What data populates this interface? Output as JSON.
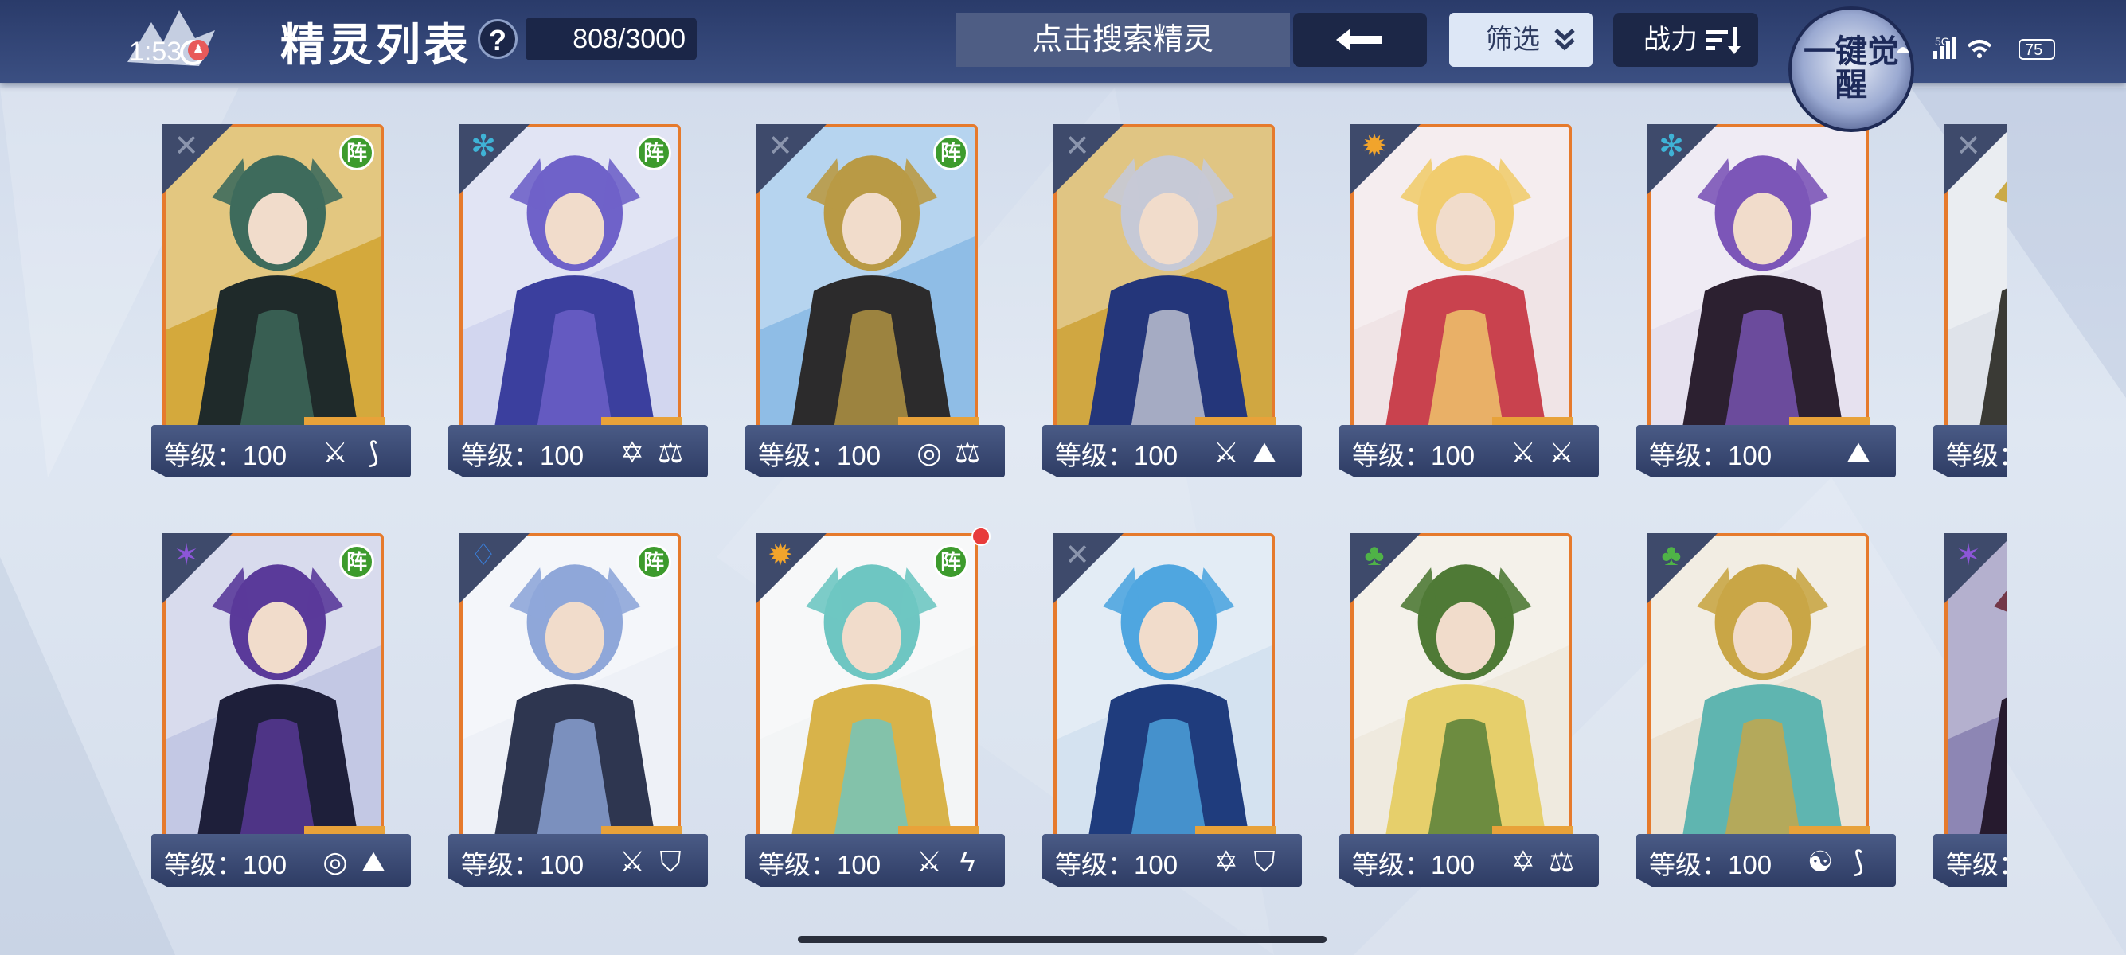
{
  "status_bar": {
    "time": "1:53",
    "network": "5G",
    "battery": "75",
    "speed": "12"
  },
  "header": {
    "title": "精灵列表",
    "help_label": "?",
    "count": "808/3000",
    "search_placeholder": "点击搜索精灵",
    "back_icon": "arrow-left-icon",
    "filter_label": "筛选",
    "power_label": "战力",
    "awaken_label": "一键觉醒"
  },
  "colors": {
    "topbar": "#2f4275",
    "card_border": "#e67a2c",
    "formation_badge": "#3d9b2d",
    "level_bar": "#3a4a74",
    "new_dot": "#e83b3b"
  },
  "cards": [
    {
      "element": "mech",
      "formation": "阵",
      "level": "等级：100",
      "skills": [
        "trident-icon",
        "claw-icon"
      ],
      "art": [
        "#1f2a2a",
        "#3e6b5c",
        "#d4a93c"
      ]
    },
    {
      "element": "ice",
      "formation": "阵",
      "level": "等级：100",
      "skills": [
        "star-icon",
        "scale-icon"
      ],
      "art": [
        "#3b3f9e",
        "#6f62c9",
        "#d2d6ef"
      ]
    },
    {
      "element": "mech",
      "formation": "阵",
      "level": "等级：100",
      "skills": [
        "spiral-icon",
        "scale-icon"
      ],
      "art": [
        "#2c2b2c",
        "#b99a45",
        "#8fbde6"
      ]
    },
    {
      "element": "mech",
      "formation": "",
      "level": "等级：100",
      "skills": [
        "trident-icon",
        "book-icon"
      ],
      "art": [
        "#24367a",
        "#c6c9d6",
        "#d0a741"
      ]
    },
    {
      "element": "light",
      "formation": "",
      "level": "等级：100",
      "skills": [
        "trident-icon",
        "trident-icon"
      ],
      "art": [
        "#c9424e",
        "#f1cc6e",
        "#f0e4e6"
      ]
    },
    {
      "element": "ice",
      "formation": "",
      "level": "等级：100",
      "skills": [
        "book-icon"
      ],
      "art": [
        "#2c2030",
        "#7c56b8",
        "#e6e1ef"
      ]
    },
    {
      "element": "mech",
      "formation": "",
      "level": "等级：",
      "skills": [],
      "art": [
        "#3a3a35",
        "#c8a233",
        "#dfe3ea"
      ]
    },
    {
      "element": "shadow",
      "formation": "阵",
      "level": "等级：100",
      "skills": [
        "spiral-icon",
        "book-icon"
      ],
      "art": [
        "#1e1f3a",
        "#5a3a9a",
        "#c3c8e4"
      ]
    },
    {
      "element": "water",
      "formation": "阵",
      "level": "等级：100",
      "skills": [
        "trident-icon",
        "shield-icon"
      ],
      "art": [
        "#2e3650",
        "#8fa7d9",
        "#eef1f7"
      ]
    },
    {
      "element": "light",
      "formation": "阵",
      "level": "等级：100",
      "skills": [
        "trident-icon",
        "lightning-icon"
      ],
      "art": [
        "#d8b34a",
        "#6ec6c2",
        "#f3f5f6"
      ],
      "new": true
    },
    {
      "element": "mech",
      "formation": "",
      "level": "等级：100",
      "skills": [
        "star-icon",
        "shield-icon"
      ],
      "art": [
        "#1f3c7d",
        "#4fa6e0",
        "#d4e2f0"
      ]
    },
    {
      "element": "grass",
      "formation": "",
      "level": "等级：100",
      "skills": [
        "star-icon",
        "scale-icon"
      ],
      "art": [
        "#e6cf6b",
        "#4f7a36",
        "#efeadf"
      ]
    },
    {
      "element": "grass",
      "formation": "",
      "level": "等级：100",
      "skills": [
        "yinyang-icon",
        "claw-icon"
      ],
      "art": [
        "#5fb5b0",
        "#c9a646",
        "#ece3d4"
      ]
    },
    {
      "element": "shadow",
      "formation": "",
      "level": "等级：",
      "skills": [],
      "art": [
        "#261a2e",
        "#6c2a3a",
        "#8d86b4"
      ]
    }
  ]
}
